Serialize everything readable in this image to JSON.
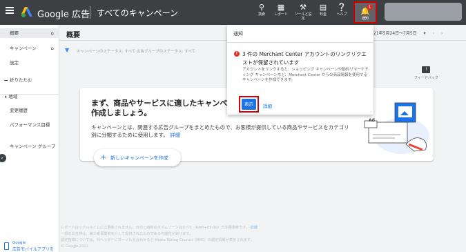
{
  "header": {
    "brand": "Google 広告",
    "page_title": "すべてのキャンペーン",
    "tools": [
      {
        "icon": "search-icon",
        "label": "検索"
      },
      {
        "icon": "reports-icon",
        "label": "レポート"
      },
      {
        "icon": "tools-icon",
        "label": "ツールと設定"
      },
      {
        "icon": "billing-icon",
        "label": "料金"
      },
      {
        "icon": "help-icon",
        "label": "ヘルプ"
      }
    ],
    "notifications": {
      "icon": "bell-icon",
      "label": "通知",
      "count": "1"
    }
  },
  "sidebar": {
    "items": [
      {
        "label": "概要"
      },
      {
        "label": "キャンペーン"
      },
      {
        "label": "設定"
      },
      {
        "label": "折りたたむ"
      },
      {
        "label": "地域"
      },
      {
        "label": "変更履歴"
      },
      {
        "label": "パフォーマンス目標"
      },
      {
        "label": "キャンペーン グループ"
      }
    ],
    "mobile": {
      "line1": "Google",
      "line2": "広告モバイルアプリを"
    }
  },
  "main": {
    "title": "概要",
    "date_range": "21年5月24日～7月5日",
    "filter": "キャンペーンのステータス: すべて  広告グループのステータス: すべて",
    "feedback": "フィードバック",
    "card": {
      "headline": "まず、商品やサービスに適したキャンペーンを作成しましょう。",
      "body": "キャンペーンとは、関連する広告グループをまとめたもので、お客様が提供している商品やサービスをカテゴリ別に分類するために使用します。",
      "body_link": "詳細",
      "create_button": "新しいキャンペーンを作成",
      "ad_badge": "Ad"
    },
    "footer": {
      "line1": "レポートはリアルタイムには更新されません。日付と時刻のタイムゾーンはすべて（GMT+09:00）日本標準時です。",
      "line1_link": "詳細",
      "line2": "一部の広告枠は、第三者事業者を介して提供されたものである可能性があります。",
      "line3": "認定指標については、列ヘッダーにカーソルを合わせると Media Rating Council（MRC）の認定情報が表示されます。",
      "line4": "© Google 2021"
    }
  },
  "notification_panel": {
    "title": "通知",
    "alert_title": "3 件の Merchant Center アカウントのリンクリクエストが保留されています",
    "alert_body": "アカウントをリンクすると、ショッピング キャンペーンや動的リマーケティング キャンペーンなど、Merchant Center からの商品情報を使用するキャンペーンを作成できます。",
    "show_button": "表示",
    "detail_link": "詳細"
  },
  "colors": {
    "topbar": "#3c4043",
    "accent": "#1a73e8",
    "highlight": "#d50000"
  }
}
